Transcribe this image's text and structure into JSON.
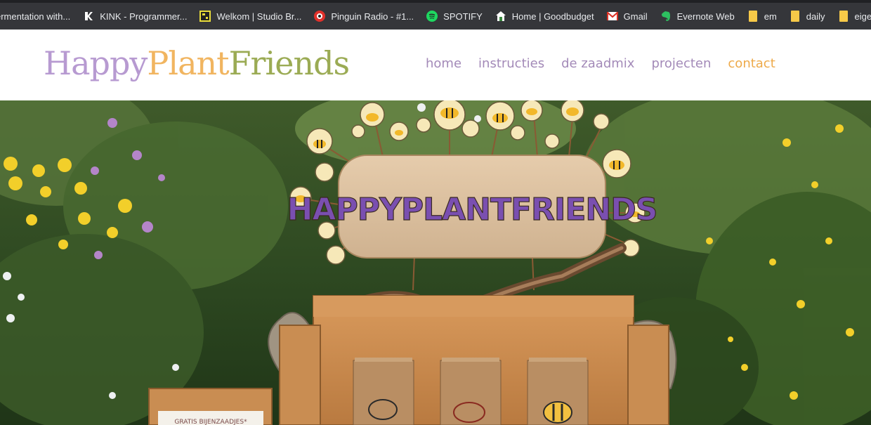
{
  "bookmarks": [
    {
      "label": "ermentation with...",
      "icon": "none"
    },
    {
      "label": "KINK - Programmer...",
      "icon": "kink-icon"
    },
    {
      "label": "Welkom | Studio Br...",
      "icon": "studio-icon"
    },
    {
      "label": "Pinguin Radio - #1...",
      "icon": "pinguin-radio-icon"
    },
    {
      "label": "SPOTIFY",
      "icon": "spotify-icon"
    },
    {
      "label": "Home | Goodbudget",
      "icon": "goodbudget-icon"
    },
    {
      "label": "Gmail",
      "icon": "gmail-icon"
    },
    {
      "label": "Evernote Web",
      "icon": "evernote-icon"
    },
    {
      "label": "em",
      "icon": "folder-icon"
    },
    {
      "label": "daily",
      "icon": "folder-icon"
    },
    {
      "label": "eigen site",
      "icon": "folder-icon"
    }
  ],
  "site": {
    "logo": {
      "part1": "Happy",
      "part2": "Plant",
      "part3": "Friends"
    },
    "nav": [
      {
        "label": "home",
        "active": false
      },
      {
        "label": "instructies",
        "active": false
      },
      {
        "label": "de zaadmix",
        "active": false
      },
      {
        "label": "projecten",
        "active": false
      },
      {
        "label": "contact",
        "active": true
      }
    ]
  },
  "hero": {
    "sign_text": "HAPPYPLANTFRIENDS",
    "card_text": "GRATIS BIJENZAADJES*"
  },
  "colors": {
    "logo_purple": "#b79ad1",
    "logo_orange": "#f1b560",
    "logo_green": "#9bab54",
    "nav_purple": "#a38ab8",
    "nav_active": "#eeaa4a"
  }
}
